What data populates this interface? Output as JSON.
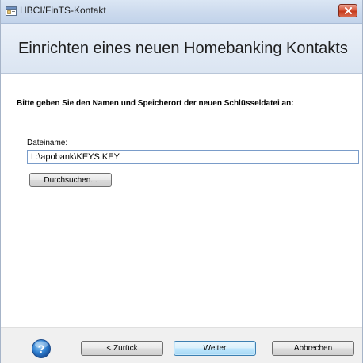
{
  "window": {
    "title": "HBCI/FinTS-Kontakt"
  },
  "header": {
    "title": "Einrichten eines neuen Homebanking Kontakts"
  },
  "content": {
    "instruction": "Bitte geben Sie den Namen und Speicherort der neuen Schlüsseldatei an:",
    "filename_label": "Dateiname:",
    "filename_value": "L:\\apobank\\KEYS.KEY",
    "browse_label": "Durchsuchen..."
  },
  "footer": {
    "back_label": "< Zurück",
    "next_label": "Weiter",
    "cancel_label": "Abbrechen"
  },
  "colors": {
    "header_bg": "#dbe5f2",
    "close_button": "#c53a1c",
    "default_button_border": "#3c7fb1"
  },
  "icons": {
    "app": "app-window-icon",
    "close": "close-icon",
    "help": "help-icon"
  }
}
